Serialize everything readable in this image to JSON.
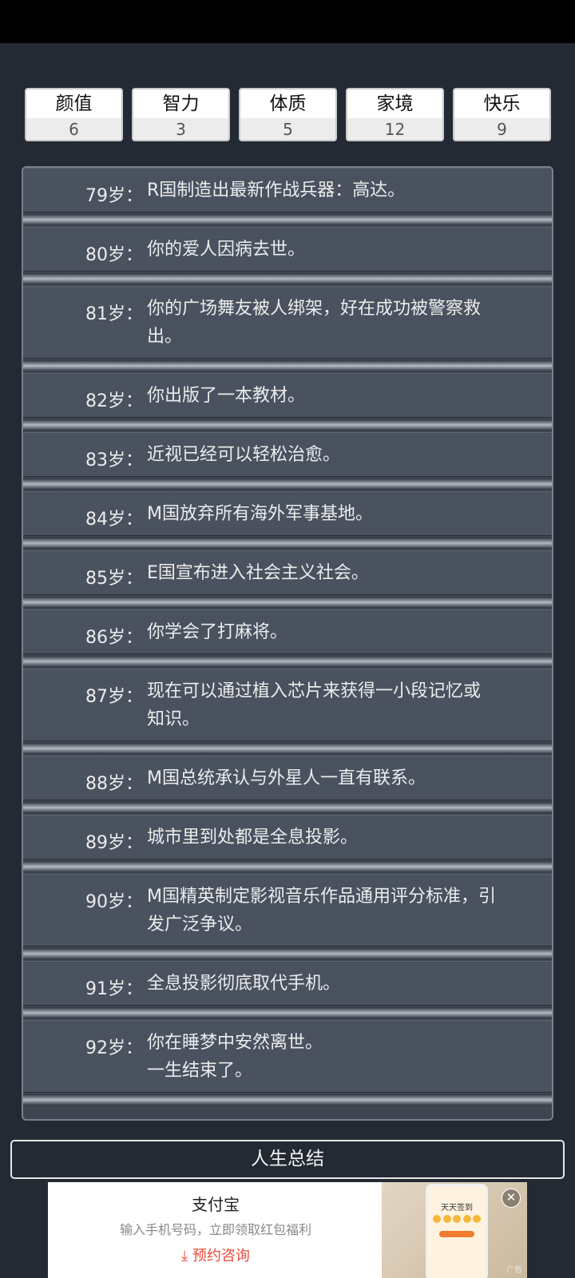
{
  "stats": [
    {
      "label": "颜值",
      "value": "6"
    },
    {
      "label": "智力",
      "value": "3"
    },
    {
      "label": "体质",
      "value": "5"
    },
    {
      "label": "家境",
      "value": "12"
    },
    {
      "label": "快乐",
      "value": "9"
    }
  ],
  "log": [
    {
      "age": "79岁：",
      "lines": [
        "R国制造出最新作战兵器：高达。"
      ]
    },
    {
      "age": "80岁：",
      "lines": [
        "你的爱人因病去世。"
      ]
    },
    {
      "age": "81岁：",
      "lines": [
        "你的广场舞友被人绑架，好在成功被警察救",
        "出。"
      ]
    },
    {
      "age": "82岁：",
      "lines": [
        "你出版了一本教材。"
      ]
    },
    {
      "age": "83岁：",
      "lines": [
        "近视已经可以轻松治愈。"
      ]
    },
    {
      "age": "84岁：",
      "lines": [
        "M国放弃所有海外军事基地。"
      ]
    },
    {
      "age": "85岁：",
      "lines": [
        "E国宣布进入社会主义社会。"
      ]
    },
    {
      "age": "86岁：",
      "lines": [
        "你学会了打麻将。"
      ]
    },
    {
      "age": "87岁：",
      "lines": [
        "现在可以通过植入芯片来获得一小段记忆或",
        "知识。"
      ]
    },
    {
      "age": "88岁：",
      "lines": [
        "M国总统承认与外星人一直有联系。"
      ]
    },
    {
      "age": "89岁：",
      "lines": [
        "城市里到处都是全息投影。"
      ]
    },
    {
      "age": "90岁：",
      "lines": [
        "M国精英制定影视音乐作品通用评分标准，引",
        "发广泛争议。"
      ]
    },
    {
      "age": "91岁：",
      "lines": [
        "全息投影彻底取代手机。"
      ]
    },
    {
      "age": "92岁：",
      "lines": [
        "你在睡梦中安然离世。",
        "一生结束了。"
      ]
    }
  ],
  "summary_button": "人生总结",
  "ad": {
    "title": "支付宝",
    "subtitle": "输入手机号码，立即领取红包福利",
    "cta": "预约咨询",
    "image_title": "天天签到",
    "tag": "广告",
    "close_icon": "close-icon"
  }
}
